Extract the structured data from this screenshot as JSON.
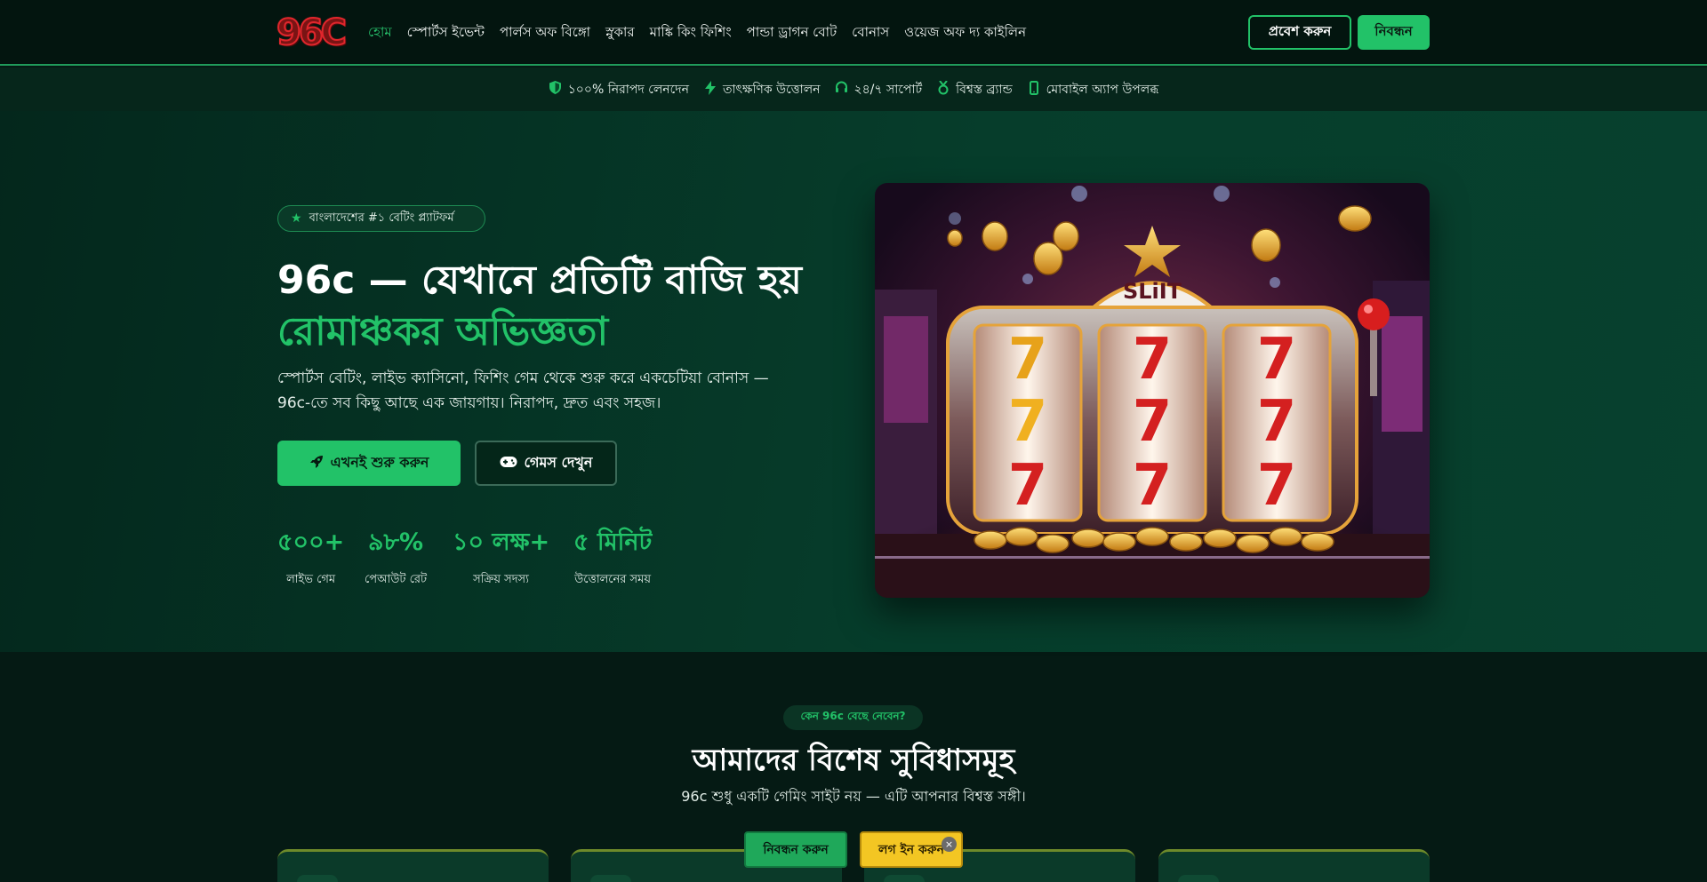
{
  "header": {
    "logo_text": "96C",
    "nav": [
      {
        "label": "হোম",
        "active": true
      },
      {
        "label": "স্পোর্টস ইভেন্ট"
      },
      {
        "label": "পার্লস অফ বিঙ্গো"
      },
      {
        "label": "স্নুকার"
      },
      {
        "label": "মাঙ্কি কিং ফিশিং"
      },
      {
        "label": "পান্ডা ড্রাগন বোট"
      },
      {
        "label": "বোনাস"
      },
      {
        "label": "ওয়েজ অফ দ্য কাইলিন"
      }
    ],
    "login_label": "প্রবেশ করুন",
    "register_label": "নিবন্ধন"
  },
  "trustbar": {
    "items": [
      {
        "icon": "shield-icon",
        "label": "১০০% নিরাপদ লেনদেন"
      },
      {
        "icon": "lightning-icon",
        "label": "তাৎক্ষণিক উত্তোলন"
      },
      {
        "icon": "headset-icon",
        "label": "২৪/৭ সাপোর্ট"
      },
      {
        "icon": "award-icon",
        "label": "বিশ্বস্ত ব্র্যান্ড"
      },
      {
        "icon": "mobile-icon",
        "label": "মোবাইল অ্যাপ উপলব্ধ"
      }
    ]
  },
  "hero": {
    "badge": "বাংলাদেশের #১ বেটিং প্ল্যাটফর্ম",
    "title_line1": "96c — যেখানে প্রতিটি বাজি হয়",
    "title_line2": "রোমাঞ্চকর অভিজ্ঞতা",
    "description": "স্পোর্টস বেটিং, লাইভ ক্যাসিনো, ফিশিং গেম থেকে শুরু করে একচেটিয়া বোনাস — 96c-তে সব কিছু আছে এক জায়গায়। নিরাপদ, দ্রুত এবং সহজ।",
    "cta_primary": "এখনই শুরু করুন",
    "cta_secondary": "গেমস দেখুন",
    "stats": [
      {
        "value": "৫০০+",
        "label": "লাইভ গেম"
      },
      {
        "value": "৯৮%",
        "label": "পেআউট রেট"
      },
      {
        "value": "১০ লক্ষ+",
        "label": "সক্রিয় সদস্য"
      },
      {
        "value": "৫ মিনিট",
        "label": "উত্তোলনের সময়"
      }
    ],
    "slot_sign": "SLiIT"
  },
  "features": {
    "badge": "কেন 96c বেছে নেবেন?",
    "title": "আমাদের বিশেষ সুবিধাসমূহ",
    "subtitle": "96c শুধু একটি গেমিং সাইট নয় — এটি আপনার বিশ্বস্ত সঙ্গী।"
  },
  "sticky": {
    "register_label": "নিবন্ধন করুন",
    "login_label": "লগ ইন করুন",
    "close_symbol": "×"
  },
  "colors": {
    "accent": "#22c268",
    "background": "#051a14",
    "login_yellow": "#f3c623"
  }
}
